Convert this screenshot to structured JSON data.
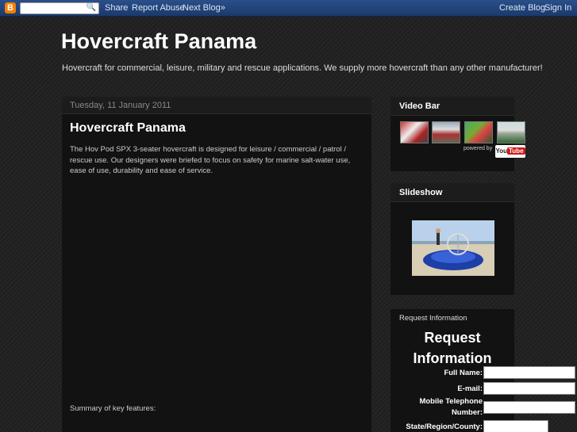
{
  "navbar": {
    "logo_letter": "B",
    "search_placeholder": "",
    "share": "Share",
    "report_abuse": "Report Abuse",
    "next_blog": "Next Blog»",
    "create_blog": "Create Blog",
    "sign_in": "Sign In"
  },
  "header": {
    "title": "Hovercraft Panama",
    "description": "Hovercraft for commercial, leisure, military and rescue applications. We supply more hovercraft than any other manufacturer!"
  },
  "post": {
    "date": "Tuesday, 11 January 2011",
    "title": "Hovercraft Panama",
    "body": "The Hov Pod SPX 3-seater hovercraft is designed for leisure / commercial / patrol / rescue use. Our designers were briefed to focus on safety for marine salt-water use, ease of use, durability and ease of service.",
    "summary": "Summary of key features:"
  },
  "sidebar": {
    "video_bar": {
      "title": "Video Bar",
      "powered_by": "powered by",
      "brand_you": "You",
      "brand_tube": "Tube"
    },
    "slideshow": {
      "title": "Slideshow"
    },
    "request": {
      "small_title": "Request Information",
      "big_title_line1": "Request",
      "big_title_line2": "Information",
      "fields": [
        {
          "label": "Full Name:"
        },
        {
          "label": "E-mail:"
        },
        {
          "label": "Mobile Telephone Number:"
        },
        {
          "label": "State/Region/County:"
        }
      ]
    }
  },
  "colors": {
    "navbar_bg": "#1b3a6b",
    "blogger_orange": "#f57d00",
    "panel_bg": "#121212"
  }
}
